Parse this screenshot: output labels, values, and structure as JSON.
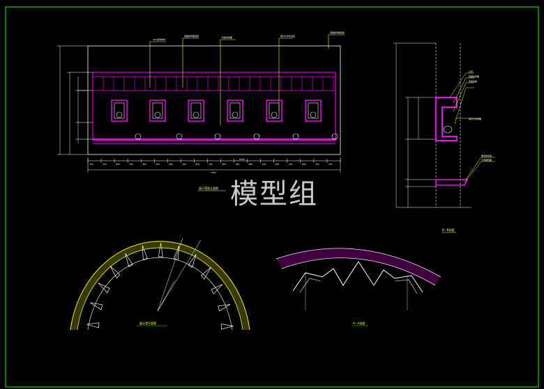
{
  "drawing": {
    "watermark": "模型组",
    "elevation_title": "展示墙面立面图",
    "section_title_right": "B—B剖面",
    "plan_title_left": "展示墙平面图",
    "section_title_arc": "A—A剖面",
    "callouts_elevation": [
      "GRC装饰构件",
      "铝塑板饰面造型",
      "乳胶漆墙面",
      "展示灯具及饰品",
      "铝塑板饰面造型"
    ],
    "callouts_section": [
      "灯具",
      "铝塑板饰面",
      "乳胶漆面",
      "展示灯具饰面",
      "钢龙骨支架",
      "不锈钢饰面"
    ],
    "dims_bottom": [
      "450",
      "300",
      "800",
      "300",
      "800",
      "300",
      "800",
      "300",
      "800",
      "300",
      "800",
      "300",
      "800",
      "300",
      "800",
      "300",
      "800",
      "300",
      "450"
    ],
    "dim_total": "7800",
    "dim_overall": "8400"
  },
  "colors": {
    "background": "#000000",
    "magenta": "#ff00ff",
    "yellow": "#ffff00",
    "white": "#ffffff",
    "green": "#00ff00",
    "wall_fill": "#c8c800"
  }
}
